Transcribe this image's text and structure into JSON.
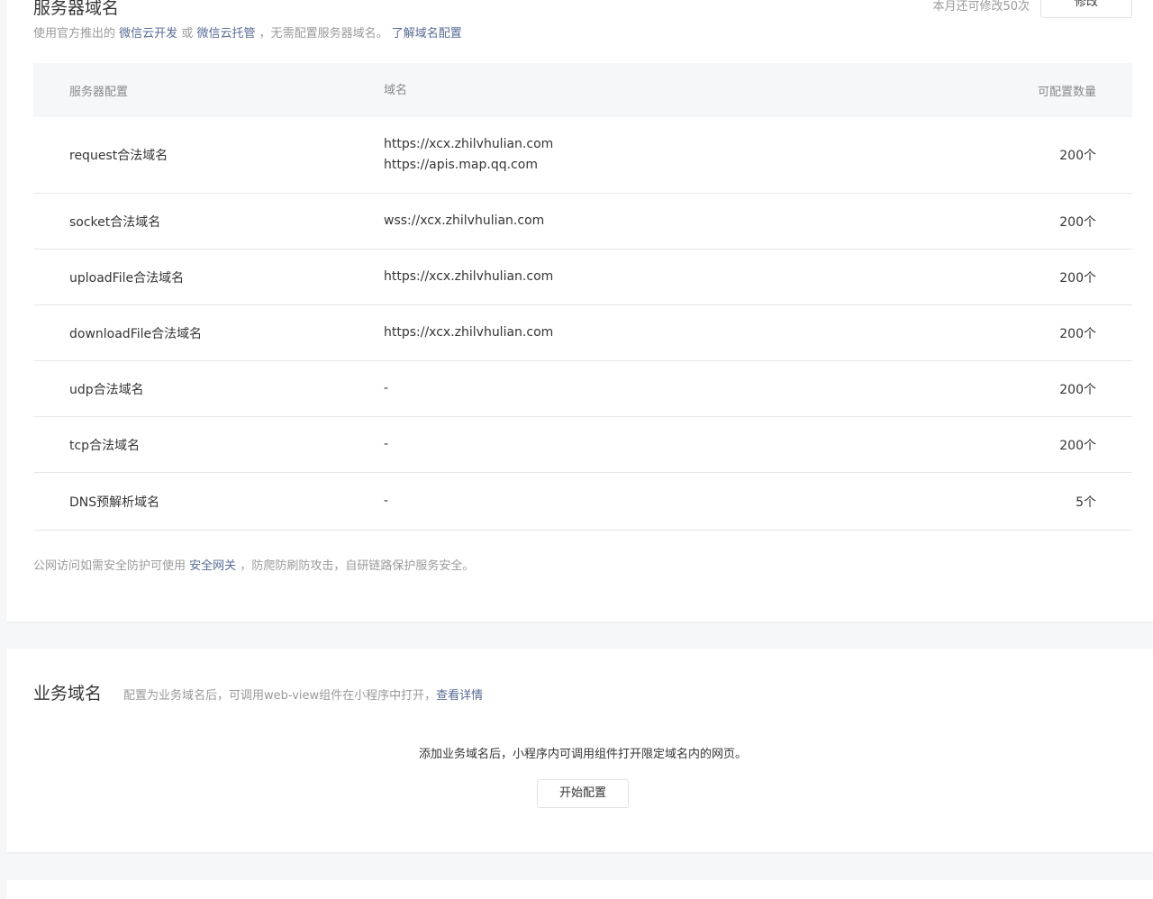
{
  "server_domain": {
    "title": "服务器域名",
    "quota_text": "本月还可修改50次",
    "edit_button": "修改",
    "desc_prefix": "使用官方推出的",
    "link_cloud_dev": "微信云开发",
    "desc_or": "或",
    "link_cloud_host": "微信云托管",
    "desc_suffix": "，无需配置服务器域名。",
    "link_learn": "了解域名配置",
    "table": {
      "headers": [
        "服务器配置",
        "域名",
        "可配置数量"
      ],
      "rows": [
        {
          "name": "request合法域名",
          "domains": [
            "https://xcx.zhilvhulian.com",
            "https://apis.map.qq.com"
          ],
          "count": "200个"
        },
        {
          "name": "socket合法域名",
          "domains": [
            "wss://xcx.zhilvhulian.com"
          ],
          "count": "200个"
        },
        {
          "name": "uploadFile合法域名",
          "domains": [
            "https://xcx.zhilvhulian.com"
          ],
          "count": "200个"
        },
        {
          "name": "downloadFile合法域名",
          "domains": [
            "https://xcx.zhilvhulian.com"
          ],
          "count": "200个"
        },
        {
          "name": "udp合法域名",
          "domains": [
            "-"
          ],
          "count": "200个"
        },
        {
          "name": "tcp合法域名",
          "domains": [
            "-"
          ],
          "count": "200个"
        },
        {
          "name": "DNS预解析域名",
          "domains": [
            "-"
          ],
          "count": "5个"
        }
      ]
    },
    "note_prefix": "公网访问如需安全防护可使用",
    "note_link": "安全网关",
    "note_suffix": "，防爬防刷防攻击，自研链路保护服务安全。"
  },
  "business_domain": {
    "title": "业务域名",
    "desc": "配置为业务域名后，可调用web-view组件在小程序中打开，",
    "link_details": "查看详情",
    "empty_text": "添加业务域名后，小程序内可调用组件打开限定域名内的网页。",
    "start_button": "开始配置"
  },
  "colors": {
    "link": "#576b95",
    "muted": "#9a9a9a",
    "text": "#353535",
    "page_bg": "#f6f7f9"
  }
}
